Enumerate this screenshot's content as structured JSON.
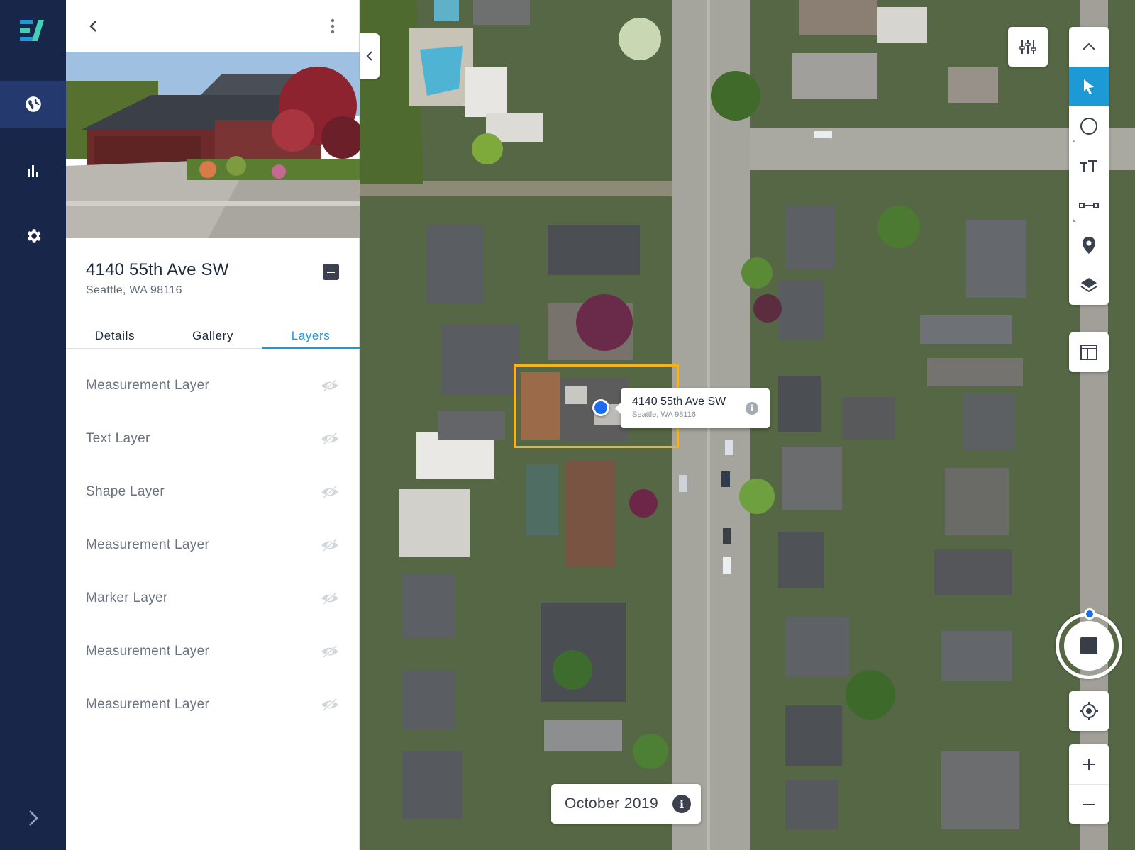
{
  "nav": {
    "items": [
      {
        "name": "globe-icon",
        "active": true
      },
      {
        "name": "bar-chart-icon",
        "active": false
      },
      {
        "name": "gear-icon",
        "active": false
      }
    ],
    "expand_icon": "chevron-right-icon"
  },
  "panel": {
    "back_icon": "chevron-left-icon",
    "menu_icon": "more-vertical-icon",
    "address": {
      "title": "4140 55th Ave SW",
      "subtitle": "Seattle, WA 98116"
    },
    "tabs": [
      {
        "label": "Details",
        "active": false
      },
      {
        "label": "Gallery",
        "active": false
      },
      {
        "label": "Layers",
        "active": true
      }
    ],
    "layers": [
      {
        "label": "Measurement Layer",
        "visible": false
      },
      {
        "label": "Text Layer",
        "visible": false
      },
      {
        "label": "Shape Layer",
        "visible": false
      },
      {
        "label": "Measurement Layer",
        "visible": false
      },
      {
        "label": "Marker Layer",
        "visible": false
      },
      {
        "label": "Measurement Layer",
        "visible": false
      },
      {
        "label": "Measurement Layer",
        "visible": false
      }
    ]
  },
  "map": {
    "callout": {
      "title": "4140 55th Ave SW",
      "subtitle": "Seattle, WA 98116"
    },
    "date_label": "October 2019",
    "tools": [
      "chevron-up-icon",
      "pointer-icon",
      "circle-icon",
      "text-size-icon",
      "measure-icon",
      "marker-pin-icon",
      "layers-icon"
    ],
    "active_tool": "pointer-icon",
    "colors": {
      "accent": "#1d9ad6",
      "selection": "#f5b31b",
      "pin": "#1a6df0",
      "rail": "#18264a"
    }
  }
}
